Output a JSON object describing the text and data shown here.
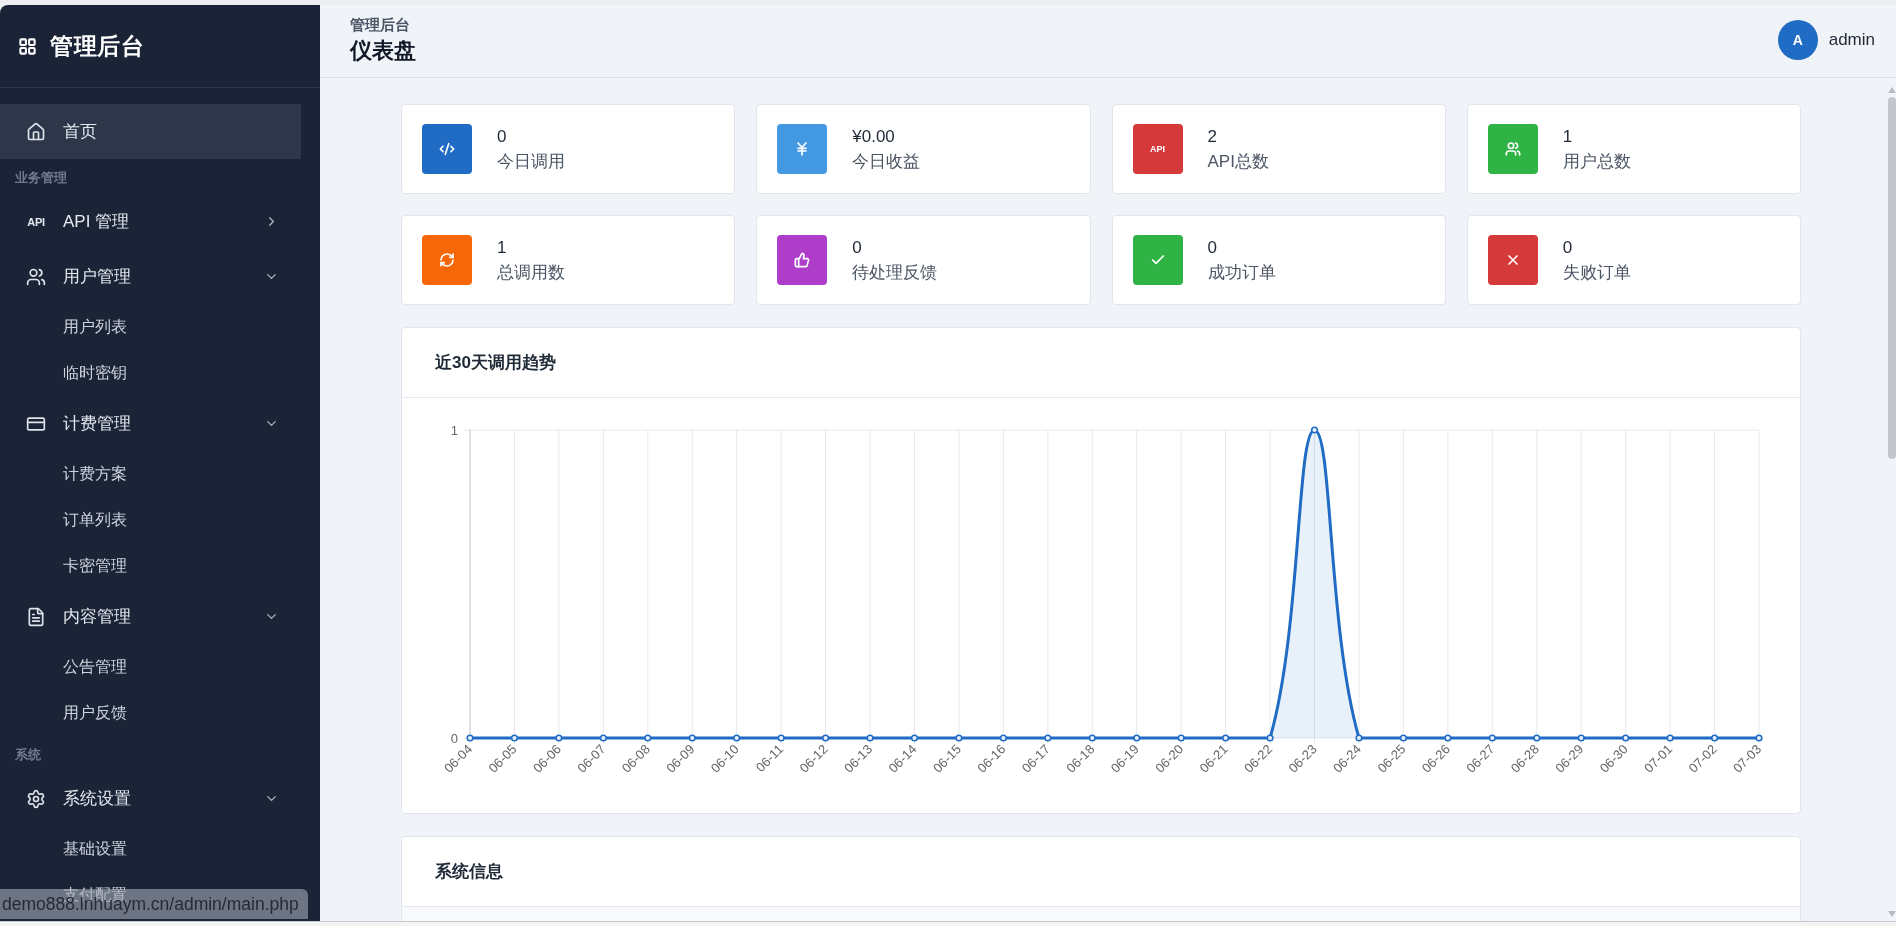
{
  "header": {
    "breadcrumb": "管理后台",
    "title": "仪表盘",
    "user": {
      "initial": "A",
      "name": "admin"
    }
  },
  "sidebar": {
    "brand": "管理后台",
    "items": [
      {
        "kind": "link",
        "label": "首页",
        "selected": true
      },
      {
        "kind": "section",
        "label": "业务管理"
      },
      {
        "kind": "group",
        "label": "API 管理",
        "icon_text": "API",
        "selected": false,
        "expanded": false
      },
      {
        "kind": "group",
        "label": "用户管理",
        "selected": false,
        "expanded": true,
        "children": [
          {
            "label": "用户列表",
            "selected": false
          },
          {
            "label": "临时密钥",
            "selected": false
          }
        ]
      },
      {
        "kind": "group",
        "label": "计费管理",
        "selected": false,
        "expanded": true,
        "children": [
          {
            "label": "计费方案",
            "selected": false
          },
          {
            "label": "订单列表",
            "selected": false
          },
          {
            "label": "卡密管理",
            "selected": false
          }
        ]
      },
      {
        "kind": "group",
        "label": "内容管理",
        "selected": false,
        "expanded": true,
        "children": [
          {
            "label": "公告管理",
            "selected": false
          },
          {
            "label": "用户反馈",
            "selected": false
          }
        ]
      },
      {
        "kind": "section",
        "label": "系统"
      },
      {
        "kind": "group",
        "label": "系统设置",
        "selected": false,
        "expanded": true,
        "children": [
          {
            "label": "基础设置",
            "selected": false
          },
          {
            "label": "支付配置",
            "selected": false
          }
        ]
      }
    ]
  },
  "stats": [
    {
      "value": "0",
      "label": "今日调用",
      "color": "#206bc4"
    },
    {
      "value": "¥0.00",
      "label": "今日收益",
      "color": "#4299e1"
    },
    {
      "value": "2",
      "label": "API总数",
      "color": "#d63939",
      "icon_text": "API"
    },
    {
      "value": "1",
      "label": "用户总数",
      "color": "#2fb344"
    },
    {
      "value": "1",
      "label": "总调用数",
      "color": "#f76707"
    },
    {
      "value": "0",
      "label": "待处理反馈",
      "color": "#ae3ec9"
    },
    {
      "value": "0",
      "label": "成功订单",
      "color": "#2fb344"
    },
    {
      "value": "0",
      "label": "失败订单",
      "color": "#d63939"
    }
  ],
  "trend_panel": {
    "title": "近30天调用趋势",
    "chart_data": {
      "type": "area",
      "categories": [
        "06-04",
        "06-05",
        "06-06",
        "06-07",
        "06-08",
        "06-09",
        "06-10",
        "06-11",
        "06-12",
        "06-13",
        "06-14",
        "06-15",
        "06-16",
        "06-17",
        "06-18",
        "06-19",
        "06-20",
        "06-21",
        "06-22",
        "06-23",
        "06-24",
        "06-25",
        "06-26",
        "06-27",
        "06-28",
        "06-29",
        "06-30",
        "07-01",
        "07-02",
        "07-03"
      ],
      "series": [
        {
          "color": "#206bc4",
          "values": [
            0,
            0,
            0,
            0,
            0,
            0,
            0,
            0,
            0,
            0,
            0,
            0,
            0,
            0,
            0,
            0,
            0,
            0,
            0,
            1,
            0,
            0,
            0,
            0,
            0,
            0,
            0,
            0,
            0,
            0
          ]
        }
      ],
      "ylim": [
        0,
        1
      ],
      "yticks": [
        0,
        1
      ],
      "grid": true
    }
  },
  "system_panel": {
    "title": "系统信息"
  },
  "status_url": "demo888.lnhuaym.cn/admin/main.php"
}
